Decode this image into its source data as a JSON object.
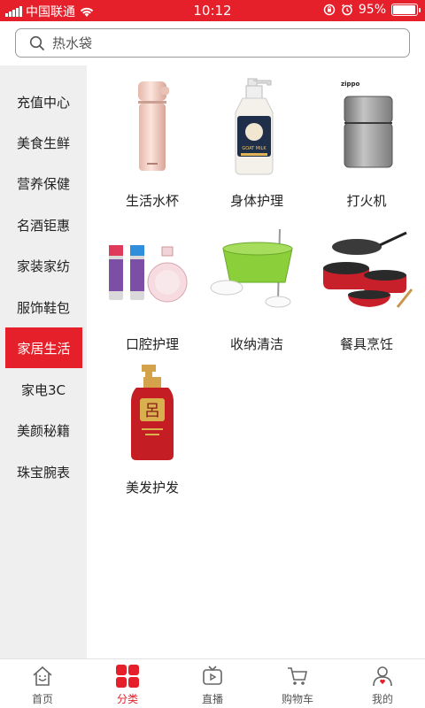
{
  "status_bar": {
    "carrier": "中国联通",
    "time": "10:12",
    "battery": "95%",
    "battery_level": 0.95
  },
  "search": {
    "placeholder": "热水袋"
  },
  "sidebar": {
    "items": [
      {
        "label": "充值中心"
      },
      {
        "label": "美食生鲜"
      },
      {
        "label": "营养保健"
      },
      {
        "label": "名酒钜惠"
      },
      {
        "label": "家装家纺"
      },
      {
        "label": "服饰鞋包"
      },
      {
        "label": "家居生活"
      },
      {
        "label": "家电3C"
      },
      {
        "label": "美颜秘籍"
      },
      {
        "label": "珠宝腕表"
      }
    ],
    "active_index": 6
  },
  "products": [
    {
      "label": "生活水杯",
      "icon": "thermos-cup-image"
    },
    {
      "label": "身体护理",
      "icon": "lotion-bottle-image",
      "brand_text": "GOAT MILK"
    },
    {
      "label": "打火机",
      "icon": "lighter-image",
      "brand_text": "zippo"
    },
    {
      "label": "口腔护理",
      "icon": "mouth-spray-image"
    },
    {
      "label": "收纳清洁",
      "icon": "mop-bucket-image"
    },
    {
      "label": "餐具烹饪",
      "icon": "cookware-image"
    },
    {
      "label": "美发护发",
      "icon": "shampoo-bottle-image",
      "brand_text": "呂"
    }
  ],
  "tabbar": {
    "tabs": [
      {
        "label": "首页",
        "icon": "home-icon"
      },
      {
        "label": "分类",
        "icon": "category-grid-icon"
      },
      {
        "label": "直播",
        "icon": "tv-icon"
      },
      {
        "label": "购物车",
        "icon": "cart-icon"
      },
      {
        "label": "我的",
        "icon": "user-icon"
      }
    ],
    "active_index": 1
  },
  "colors": {
    "accent": "#e5202a",
    "sidebar_bg": "#efefef"
  }
}
